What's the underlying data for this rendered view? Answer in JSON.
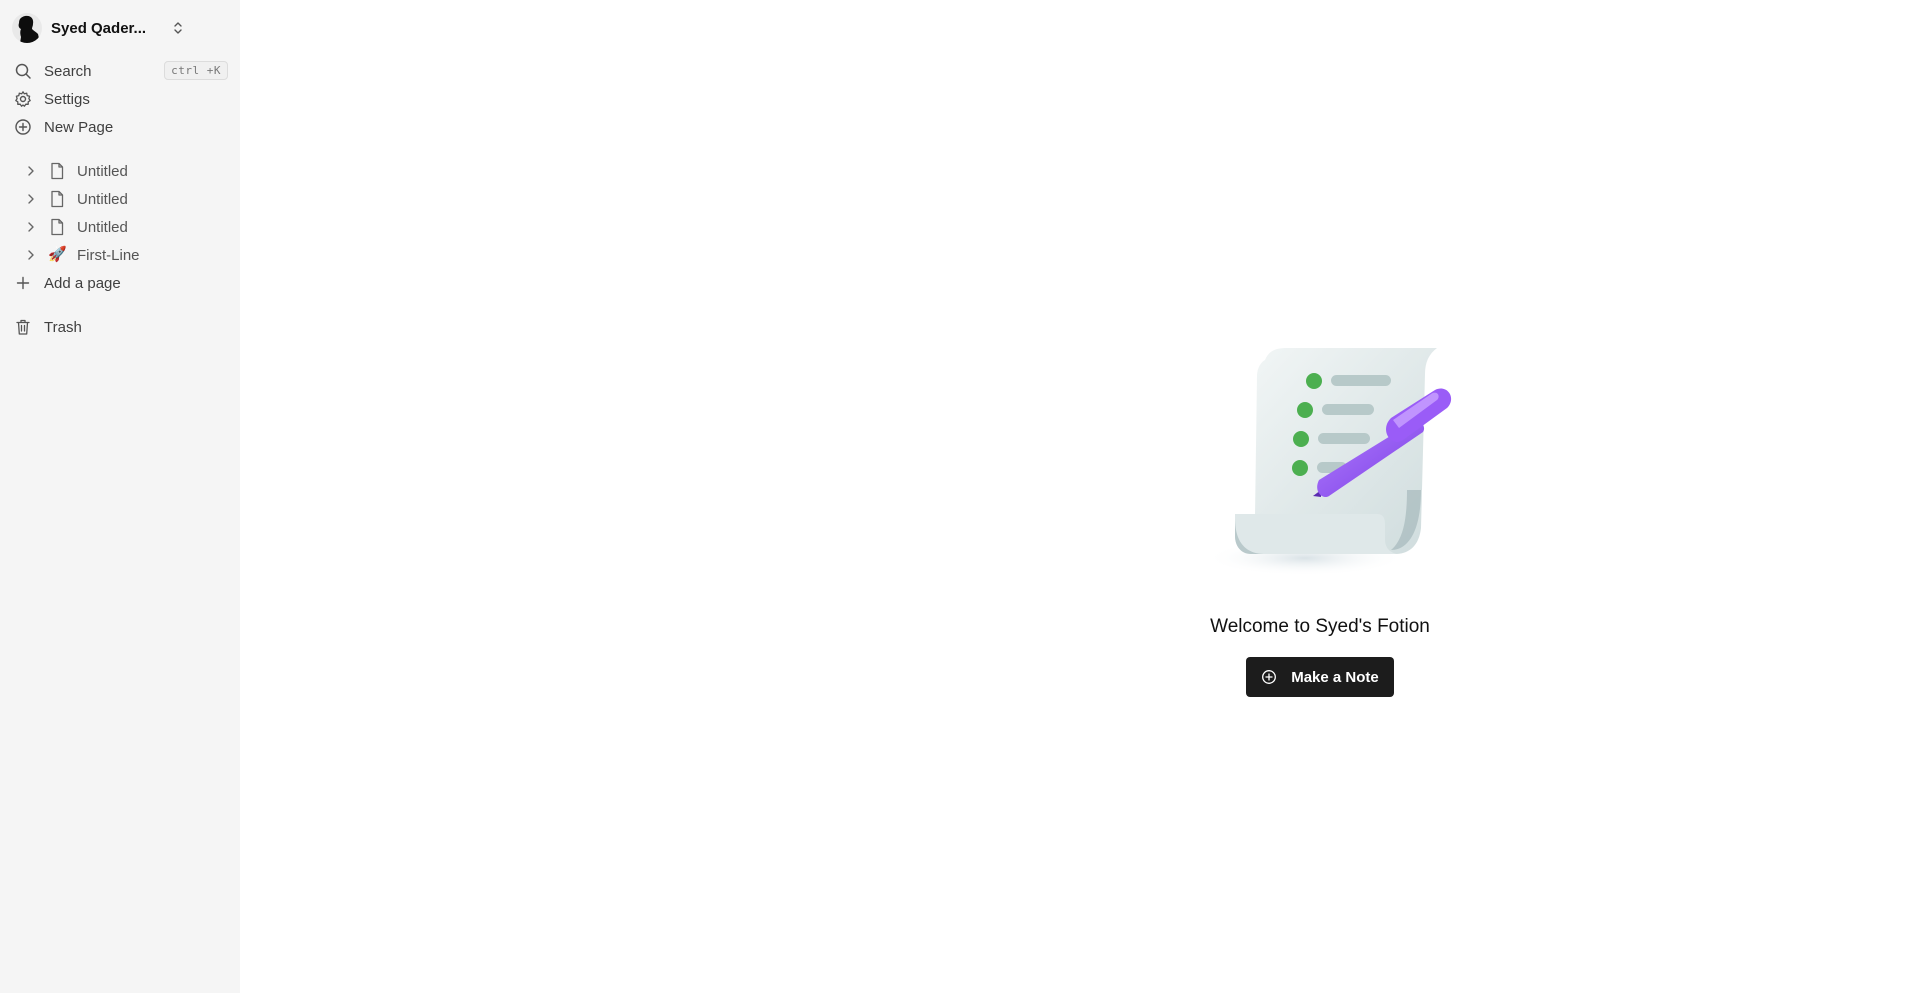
{
  "sidebar": {
    "user": {
      "name": "Syed Qader...",
      "avatar_icon": "user-silhouette"
    },
    "nav": {
      "search_label": "Search",
      "search_shortcut": "ctrl +K",
      "settings_label": "Settigs",
      "new_page_label": "New Page"
    },
    "pages": [
      {
        "title": "Untitled",
        "icon": "document-icon"
      },
      {
        "title": "Untitled",
        "icon": "document-icon"
      },
      {
        "title": "Untitled",
        "icon": "document-icon"
      },
      {
        "title": "First-Line",
        "icon": "🚀"
      }
    ],
    "add_page_label": "Add a page",
    "trash_label": "Trash"
  },
  "main": {
    "welcome_text": "Welcome to Syed's Fotion",
    "cta_label": "Make a Note"
  },
  "colors": {
    "sidebar_bg": "#f5f5f5",
    "cta_bg": "#1c1c1c",
    "accent_purple": "#8b4cf0",
    "accent_green": "#4caf50"
  }
}
